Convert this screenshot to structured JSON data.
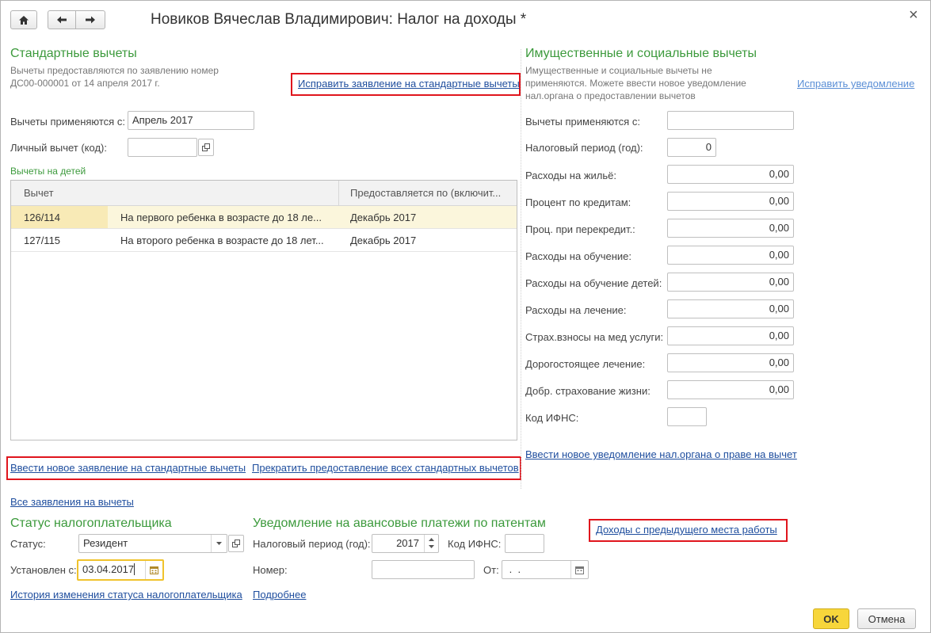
{
  "window": {
    "title": "Новиков Вячеслав Владимирович: Налог на доходы *",
    "close_glyph": "×"
  },
  "standard": {
    "title": "Стандартные вычеты",
    "note_line1": "Вычеты предоставляются по заявлению номер",
    "note_line2": "ДС00-000001 от 14 апреля 2017 г.",
    "edit_link": "Исправить заявление на стандартные вычеты",
    "applied_from_label": "Вычеты применяются с:",
    "applied_from_value": "Апрель 2017",
    "personal_label": "Личный вычет (код):",
    "personal_value": "",
    "children_title": "Вычеты на детей",
    "table": {
      "headers": [
        "Вычет",
        "Предоставляется по (включит..."
      ],
      "rows": [
        {
          "code": "126/114",
          "desc": "На первого ребенка в возрасте до 18 ле...",
          "until": "Декабрь 2017"
        },
        {
          "code": "127/115",
          "desc": "На второго ребенка в возрасте до 18 лет...",
          "until": "Декабрь 2017"
        }
      ]
    },
    "new_link": "Ввести новое заявление на стандартные вычеты",
    "stop_link": "Прекратить предоставление всех стандартных вычетов",
    "all_link": "Все заявления на вычеты"
  },
  "property": {
    "title": "Имущественные и социальные вычеты",
    "note_line1": "Имущественные и социальные вычеты не",
    "note_line2": "применяются. Можете ввести новое уведомление",
    "note_line3": "нал.органа о предоставлении вычетов",
    "edit_link": "Исправить уведомление",
    "applied_label": "Вычеты применяются с:",
    "applied_value": "",
    "period_label": "Налоговый период (год):",
    "period_value": "0",
    "fields": [
      {
        "label": "Расходы на жильё:",
        "value": "0,00"
      },
      {
        "label": "Процент по кредитам:",
        "value": "0,00"
      },
      {
        "label": "Проц. при перекредит.:",
        "value": "0,00"
      },
      {
        "label": "Расходы на обучение:",
        "value": "0,00"
      },
      {
        "label": "Расходы на обучение детей:",
        "value": "0,00"
      },
      {
        "label": "Расходы на лечение:",
        "value": "0,00"
      },
      {
        "label": "Страх.взносы на мед услуги:",
        "value": "0,00"
      },
      {
        "label": "Дорогостоящее лечение:",
        "value": "0,00"
      },
      {
        "label": "Добр. страхование жизни:",
        "value": "0,00"
      }
    ],
    "ifns_label": "Код ИФНС:",
    "ifns_value": "",
    "new_link": "Ввести новое уведомление нал.органа о праве на вычет"
  },
  "status": {
    "title": "Статус налогоплательщика",
    "status_label": "Статус:",
    "status_value": "Резидент",
    "since_label": "Установлен с:",
    "since_value": "03.04.2017",
    "history_link": "История изменения статуса налогоплательщика"
  },
  "patent": {
    "title": "Уведомление на авансовые платежи по патентам",
    "period_label": "Налоговый период (год):",
    "period_value": "2017",
    "ifns_label": "Код ИФНС:",
    "ifns_value": "",
    "number_label": "Номер:",
    "number_value": "",
    "from_label": "От:",
    "from_value": " .  .",
    "more_link": "Подробнее"
  },
  "prev_work_link": "Доходы с предыдущего места работы",
  "buttons": {
    "ok": "OK",
    "cancel": "Отмена"
  },
  "colors": {
    "accent_green": "#3c9a3c",
    "link_blue": "#1f4e9e",
    "highlight_red": "#e0151d",
    "ok_yellow": "#f7d63b",
    "selected_row": "#fbf6dc"
  }
}
